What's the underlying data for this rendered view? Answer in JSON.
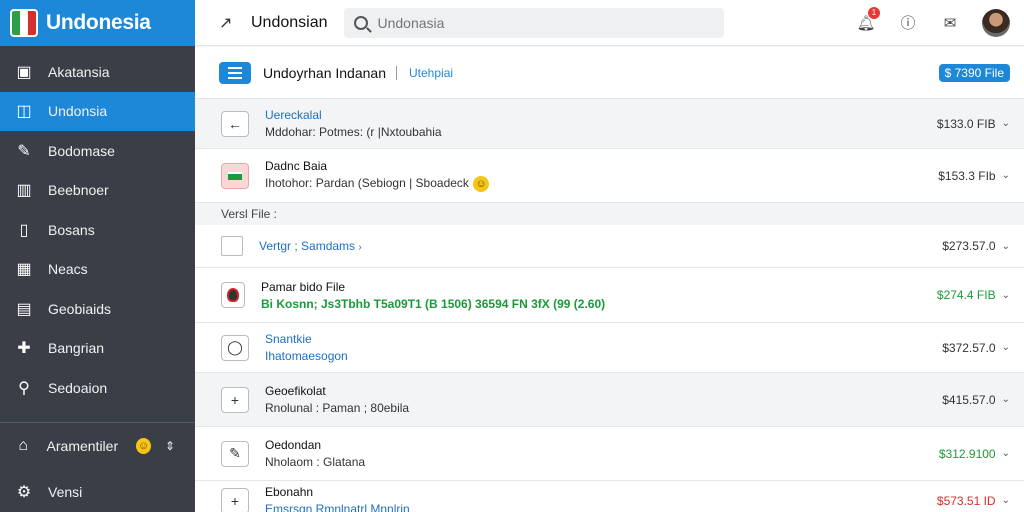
{
  "brand": {
    "name": "Undonesia"
  },
  "sidebar": {
    "items": [
      {
        "label": "Akatansia",
        "icon": "image-icon"
      },
      {
        "label": "Undonsia",
        "icon": "chart-icon",
        "active": true
      },
      {
        "label": "Bodomase",
        "icon": "wrench-icon"
      },
      {
        "label": "Beebnoer",
        "icon": "bars-icon"
      },
      {
        "label": "Bosans",
        "icon": "columns-icon"
      },
      {
        "label": "Neacs",
        "icon": "grid-icon"
      },
      {
        "label": "Geobiaids",
        "icon": "table-icon"
      },
      {
        "label": "Bangrian",
        "icon": "puzzle-icon"
      },
      {
        "label": "Sedoaion",
        "icon": "search-icon"
      }
    ],
    "footer": [
      {
        "label": "Aramentiler",
        "icon": "home-icon"
      },
      {
        "label": "Vensi",
        "icon": "settings-icon"
      }
    ]
  },
  "topbar": {
    "title": "Undonsian",
    "search_placeholder": "Undonasia",
    "notification_count": "1"
  },
  "header": {
    "title": "Undoyrhan Indanan",
    "link": "Utehpiai",
    "button": "$ 7390 File"
  },
  "rows_top": [
    {
      "title": "Uereckalal",
      "subtitle": "Mddohar: Potmes: (r |Nxtoubahia",
      "amount": "$133.0 FIB",
      "icon": "back-arrow-icon",
      "bg": "grey",
      "title_blue": true
    },
    {
      "title": "Dadnc Baia",
      "subtitle": "Ihotohor: Pardan (Sebiogn | Sboadeck",
      "amount": "$153.3 FIb",
      "icon": "flag-icon",
      "bg": "white"
    }
  ],
  "section_label": "Versl File :",
  "rows_bottom": [
    {
      "title": "Vertgr ; Samdams",
      "subtitle": "",
      "amount": "$273.57.0",
      "icon": "checkbox-icon",
      "bg": "white",
      "title_blue": true
    },
    {
      "title": "Pamar bido File",
      "subtitle": "Bi Kosnn; Js3Tbhb T5a09T1 (B 1506) 36594 FN 3fX (99 (2.60)",
      "amount": "$274.4 FIB",
      "amount_color": "green",
      "icon": "badge-icon",
      "bg": "white"
    },
    {
      "title": "Snantkie",
      "subtitle": "Ihatomaesogon",
      "amount": "$372.57.0",
      "icon": "pin-icon",
      "bg": "white",
      "title_blue": true,
      "sub_blue": true
    },
    {
      "title": "Geoefikolat",
      "subtitle": "Rnolunal : Paman ; 80ebila",
      "amount": "$415.57.0",
      "icon": "plus-icon",
      "bg": "grey"
    },
    {
      "title": "Oedondan",
      "subtitle": "Nholaom : Glatana",
      "amount": "$312.9100",
      "amount_color": "green",
      "icon": "edit-icon",
      "bg": "white"
    },
    {
      "title": "Ebonahn",
      "subtitle": "Emsrsgn Rmnlnatrl Mnnlrin",
      "amount": "$573.51 ID",
      "amount_color": "red",
      "icon": "plus-icon",
      "bg": "white"
    }
  ],
  "colors": {
    "accent": "#1e88d8",
    "sidebar": "#3a3f47",
    "green": "#1a9a3a",
    "red": "#d32f2f"
  }
}
